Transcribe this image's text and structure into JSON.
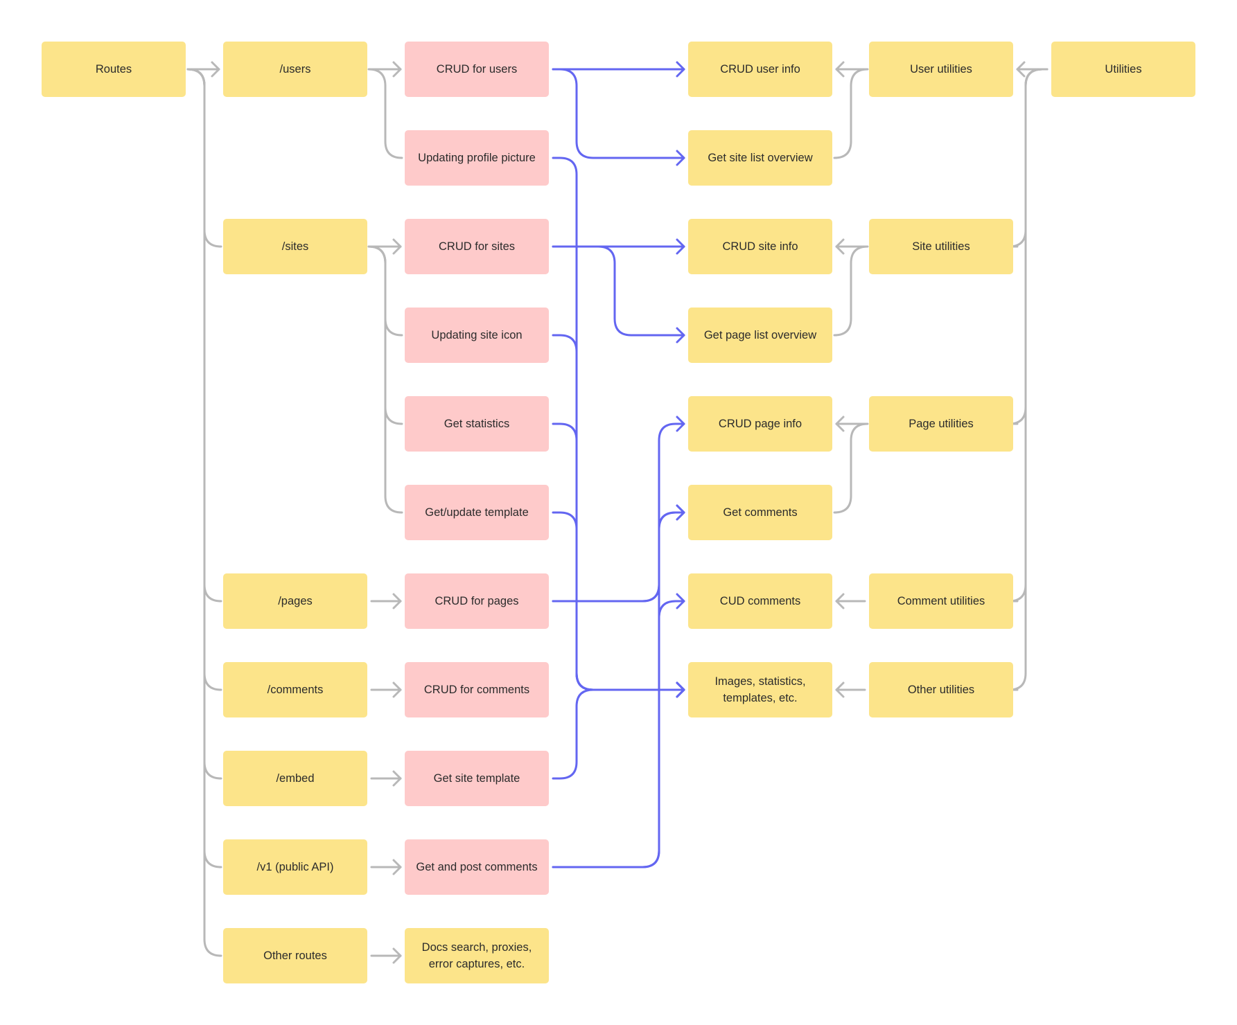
{
  "diagram": {
    "colors": {
      "route_node": "#fce48a",
      "handler_node": "#fecaca",
      "utility_node": "#fce48a",
      "gray_edge": "#b8b8b8",
      "blue_edge": "#6366f1",
      "text": "#2b2b2b"
    },
    "nodes": [
      {
        "id": "routes",
        "label": "Routes",
        "kind": "yellow",
        "col": 0,
        "row": 0
      },
      {
        "id": "users",
        "label": "/users",
        "kind": "yellow",
        "col": 1,
        "row": 0
      },
      {
        "id": "sites",
        "label": "/sites",
        "kind": "yellow",
        "col": 1,
        "row": 2
      },
      {
        "id": "pages",
        "label": "/pages",
        "kind": "yellow",
        "col": 1,
        "row": 6
      },
      {
        "id": "comments",
        "label": "/comments",
        "kind": "yellow",
        "col": 1,
        "row": 7
      },
      {
        "id": "embed",
        "label": "/embed",
        "kind": "yellow",
        "col": 1,
        "row": 8
      },
      {
        "id": "v1",
        "label": "/v1 (public API)",
        "kind": "yellow",
        "col": 1,
        "row": 9
      },
      {
        "id": "other_routes",
        "label": "Other routes",
        "kind": "yellow",
        "col": 1,
        "row": 10
      },
      {
        "id": "crud_users",
        "label": "CRUD for users",
        "kind": "pink",
        "col": 2,
        "row": 0
      },
      {
        "id": "upd_profile",
        "label": "Updating profile picture",
        "kind": "pink",
        "col": 2,
        "row": 1
      },
      {
        "id": "crud_sites",
        "label": "CRUD for sites",
        "kind": "pink",
        "col": 2,
        "row": 2
      },
      {
        "id": "upd_icon",
        "label": "Updating site icon",
        "kind": "pink",
        "col": 2,
        "row": 3
      },
      {
        "id": "get_stats",
        "label": "Get statistics",
        "kind": "pink",
        "col": 2,
        "row": 4
      },
      {
        "id": "get_upd_tpl",
        "label": "Get/update template",
        "kind": "pink",
        "col": 2,
        "row": 5
      },
      {
        "id": "crud_pages",
        "label": "CRUD for pages",
        "kind": "pink",
        "col": 2,
        "row": 6
      },
      {
        "id": "crud_comments",
        "label": "CRUD for comments",
        "kind": "pink",
        "col": 2,
        "row": 7
      },
      {
        "id": "get_site_tpl",
        "label": "Get site template",
        "kind": "pink",
        "col": 2,
        "row": 8
      },
      {
        "id": "get_post_comments",
        "label": "Get and post comments",
        "kind": "pink",
        "col": 2,
        "row": 9
      },
      {
        "id": "docs_search",
        "label": "Docs search, proxies, error captures, etc.",
        "kind": "yellow",
        "col": 2,
        "row": 10
      },
      {
        "id": "crud_user_info",
        "label": "CRUD user info",
        "kind": "yellow",
        "col": 3,
        "row": 0
      },
      {
        "id": "site_list",
        "label": "Get site list overview",
        "kind": "yellow",
        "col": 3,
        "row": 1
      },
      {
        "id": "crud_site_info",
        "label": "CRUD site info",
        "kind": "yellow",
        "col": 3,
        "row": 2
      },
      {
        "id": "page_list",
        "label": "Get page list overview",
        "kind": "yellow",
        "col": 3,
        "row": 3
      },
      {
        "id": "crud_page_info",
        "label": "CRUD page info",
        "kind": "yellow",
        "col": 3,
        "row": 4
      },
      {
        "id": "get_comments",
        "label": "Get comments",
        "kind": "yellow",
        "col": 3,
        "row": 5
      },
      {
        "id": "cud_comments",
        "label": "CUD comments",
        "kind": "yellow",
        "col": 3,
        "row": 6
      },
      {
        "id": "images_misc",
        "label": "Images, statistics, templates, etc.",
        "kind": "yellow",
        "col": 3,
        "row": 7
      },
      {
        "id": "user_utils",
        "label": "User utilities",
        "kind": "yellow",
        "col": 4,
        "row": 0
      },
      {
        "id": "site_utils",
        "label": "Site utilities",
        "kind": "yellow",
        "col": 4,
        "row": 2
      },
      {
        "id": "page_utils",
        "label": "Page utilities",
        "kind": "yellow",
        "col": 4,
        "row": 4
      },
      {
        "id": "comment_utils",
        "label": "Comment utilities",
        "kind": "yellow",
        "col": 4,
        "row": 6
      },
      {
        "id": "other_utils",
        "label": "Other utilities",
        "kind": "yellow",
        "col": 4,
        "row": 7
      },
      {
        "id": "utilities",
        "label": "Utilities",
        "kind": "yellow",
        "col": 5,
        "row": 0
      }
    ],
    "edges": [
      {
        "from": "routes",
        "to": "users",
        "color": "gray"
      },
      {
        "from": "routes",
        "to": "sites",
        "color": "gray"
      },
      {
        "from": "routes",
        "to": "pages",
        "color": "gray"
      },
      {
        "from": "routes",
        "to": "comments",
        "color": "gray"
      },
      {
        "from": "routes",
        "to": "embed",
        "color": "gray"
      },
      {
        "from": "routes",
        "to": "v1",
        "color": "gray"
      },
      {
        "from": "routes",
        "to": "other_routes",
        "color": "gray"
      },
      {
        "from": "users",
        "to": "crud_users",
        "color": "gray"
      },
      {
        "from": "users",
        "to": "upd_profile",
        "color": "gray"
      },
      {
        "from": "sites",
        "to": "crud_sites",
        "color": "gray"
      },
      {
        "from": "sites",
        "to": "upd_icon",
        "color": "gray"
      },
      {
        "from": "sites",
        "to": "get_stats",
        "color": "gray"
      },
      {
        "from": "sites",
        "to": "get_upd_tpl",
        "color": "gray"
      },
      {
        "from": "pages",
        "to": "crud_pages",
        "color": "gray"
      },
      {
        "from": "comments",
        "to": "crud_comments",
        "color": "gray"
      },
      {
        "from": "embed",
        "to": "get_site_tpl",
        "color": "gray"
      },
      {
        "from": "v1",
        "to": "get_post_comments",
        "color": "gray"
      },
      {
        "from": "other_routes",
        "to": "docs_search",
        "color": "gray"
      },
      {
        "from": "crud_users",
        "to": "crud_user_info",
        "color": "blue"
      },
      {
        "from": "crud_users",
        "to": "site_list",
        "color": "blue"
      },
      {
        "from": "crud_sites",
        "to": "crud_site_info",
        "color": "blue"
      },
      {
        "from": "crud_sites",
        "to": "page_list",
        "color": "blue"
      },
      {
        "from": "upd_profile",
        "to": "images_misc",
        "color": "blue"
      },
      {
        "from": "upd_icon",
        "to": "images_misc",
        "color": "blue"
      },
      {
        "from": "get_stats",
        "to": "images_misc",
        "color": "blue"
      },
      {
        "from": "get_upd_tpl",
        "to": "images_misc",
        "color": "blue"
      },
      {
        "from": "get_site_tpl",
        "to": "images_misc",
        "color": "blue"
      },
      {
        "from": "crud_pages",
        "to": "crud_page_info",
        "color": "blue"
      },
      {
        "from": "crud_pages",
        "to": "get_comments",
        "color": "blue"
      },
      {
        "from": "get_post_comments",
        "to": "get_comments",
        "color": "blue"
      },
      {
        "from": "get_post_comments",
        "to": "cud_comments",
        "color": "blue"
      },
      {
        "from": "utilities",
        "to": "user_utils",
        "color": "gray"
      },
      {
        "from": "utilities",
        "to": "site_utils",
        "color": "gray"
      },
      {
        "from": "utilities",
        "to": "page_utils",
        "color": "gray"
      },
      {
        "from": "utilities",
        "to": "comment_utils",
        "color": "gray"
      },
      {
        "from": "utilities",
        "to": "other_utils",
        "color": "gray"
      },
      {
        "from": "user_utils",
        "to": "crud_user_info",
        "color": "gray"
      },
      {
        "from": "user_utils",
        "to": "site_list",
        "color": "gray"
      },
      {
        "from": "site_utils",
        "to": "crud_site_info",
        "color": "gray"
      },
      {
        "from": "site_utils",
        "to": "page_list",
        "color": "gray"
      },
      {
        "from": "page_utils",
        "to": "crud_page_info",
        "color": "gray"
      },
      {
        "from": "page_utils",
        "to": "get_comments",
        "color": "gray"
      },
      {
        "from": "comment_utils",
        "to": "cud_comments",
        "color": "gray"
      },
      {
        "from": "other_utils",
        "to": "images_misc",
        "color": "gray"
      }
    ]
  }
}
